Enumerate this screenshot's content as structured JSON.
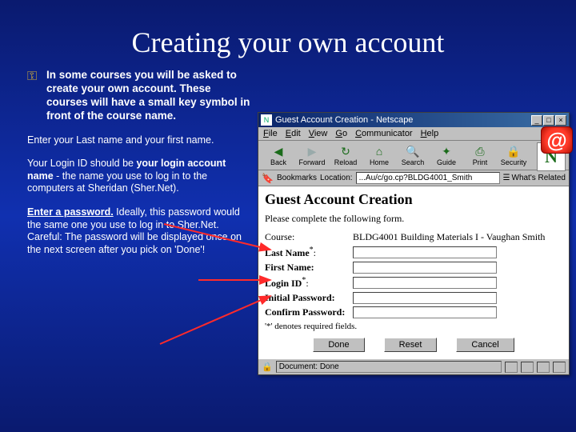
{
  "title": "Creating your own account",
  "bullet": "In some courses you will be asked to create your own account. These courses will have a small key symbol in front of the course name.",
  "p_lastname": "Enter your Last name and your first name.",
  "p_login_pre": "Your Login ID should be ",
  "p_login_bold": "your login account name",
  "p_login_post": " - the name you use to log in to the computers at Sheridan (Sher.Net).",
  "p_pw_lead_u": "Enter a password.",
  "p_pw_rest": "  Ideally, this password would the same one you use to log in to Sher.Net. Careful: The password will be displayed once on the next screen after you pick on 'Done'!",
  "window": {
    "title": "Guest Account Creation - Netscape",
    "menu": [
      "File",
      "Edit",
      "View",
      "Go",
      "Communicator",
      "Help"
    ],
    "toolbar": {
      "back": "Back",
      "forward": "Forward",
      "reload": "Reload",
      "home": "Home",
      "search": "Search",
      "guide": "Guide",
      "print": "Print",
      "security": "Security"
    },
    "bookmarks": "Bookmarks",
    "location_label": "Location:",
    "location": "...Au/c/go.cp?BLDG4001_Smith",
    "related": "What's Related",
    "page_heading": "Guest Account Creation",
    "page_lead": "Please complete the following form.",
    "fields": {
      "course_lbl": "Course:",
      "course_val": "BLDG4001 Building Materials I - Vaughan Smith",
      "last": "Last Name",
      "first": "First Name:",
      "login": "Login ID",
      "ipw": "Initial Password:",
      "cpw": "Confirm Password:"
    },
    "req_note": "'*' denotes required fields.",
    "buttons": {
      "done": "Done",
      "reset": "Reset",
      "cancel": "Cancel"
    },
    "status": "Document: Done"
  },
  "at": "@"
}
